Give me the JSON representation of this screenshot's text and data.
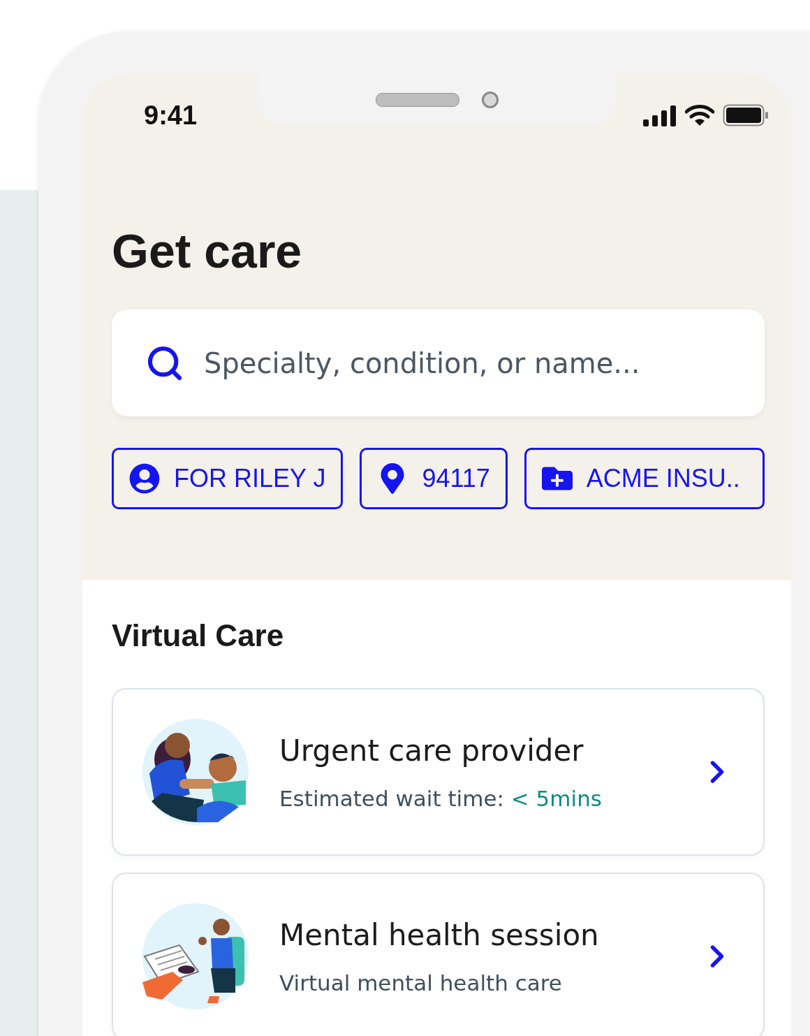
{
  "status_bar": {
    "time": "9:41"
  },
  "title": "Get care",
  "search": {
    "placeholder": "Specialty, condition, or name..."
  },
  "filters": [
    {
      "kind": "person",
      "label": "FOR RILEY J"
    },
    {
      "kind": "location",
      "label": "94117"
    },
    {
      "kind": "insurance",
      "label": "ACME INSU.."
    }
  ],
  "sections": [
    {
      "title": "Virtual Care",
      "items": [
        {
          "kind": "urgent",
          "title": "Urgent care provider",
          "subtitle": "Estimated wait time:",
          "highlight": "< 5mins"
        },
        {
          "kind": "mental",
          "title": "Mental health session",
          "subtitle": "Virtual mental health care"
        }
      ]
    }
  ]
}
